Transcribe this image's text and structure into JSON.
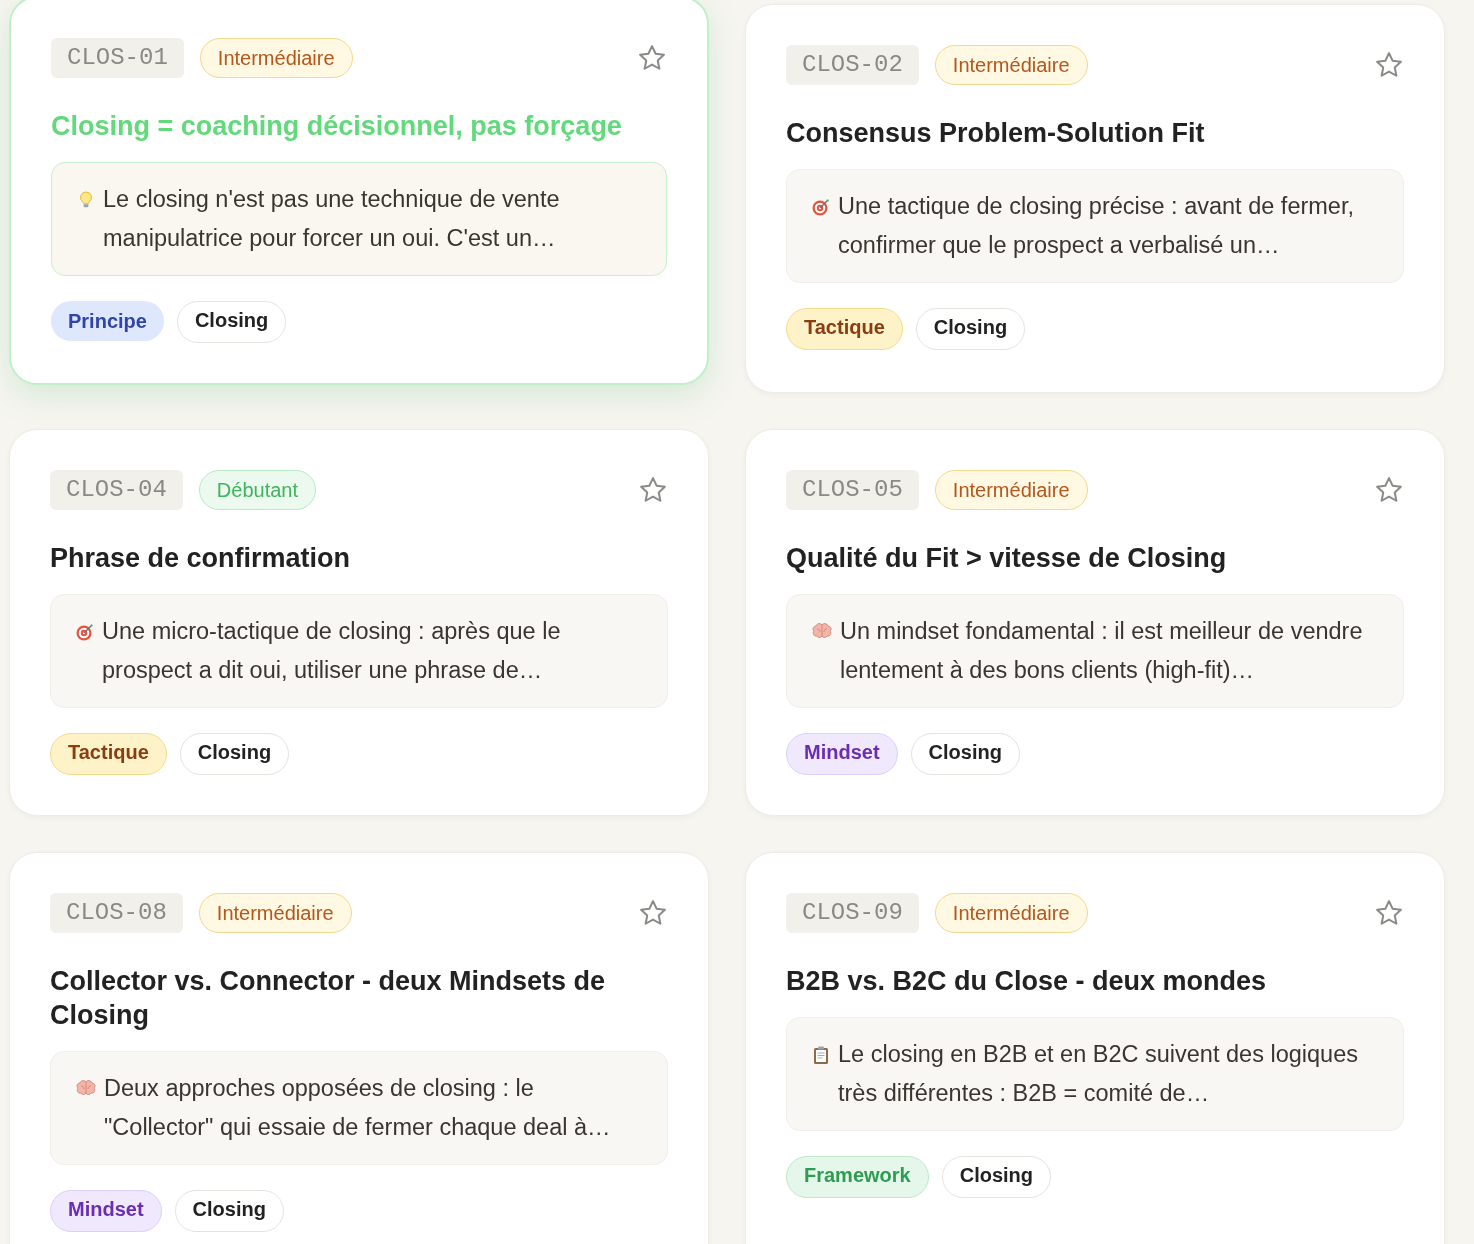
{
  "cards": [
    {
      "id": "CLOS-01",
      "selected": true,
      "starred": false,
      "difficulty": {
        "label": "Intermédiaire",
        "kind": "intermediate"
      },
      "title": "Closing = coaching décisionnel, pas forçage",
      "summary": {
        "kind": "idea",
        "text": "Le closing n'est pas une technique de vente manipulatrice pour forcer un oui. C'est un…"
      },
      "tags": [
        {
          "label": "Principe",
          "kind": "principle"
        },
        {
          "label": "Closing",
          "kind": "topic"
        }
      ]
    },
    {
      "id": "CLOS-02",
      "selected": false,
      "starred": false,
      "difficulty": {
        "label": "Intermédiaire",
        "kind": "intermediate"
      },
      "title": "Consensus Problem-Solution Fit",
      "summary": {
        "kind": "tactic",
        "text": "Une tactique de closing précise : avant de fermer, confirmer que le prospect a verbalisé un…"
      },
      "tags": [
        {
          "label": "Tactique",
          "kind": "tactic"
        },
        {
          "label": "Closing",
          "kind": "topic"
        }
      ]
    },
    {
      "id": "CLOS-04",
      "selected": false,
      "starred": false,
      "difficulty": {
        "label": "Débutant",
        "kind": "beginner"
      },
      "title": "Phrase de confirmation",
      "summary": {
        "kind": "tactic",
        "text": "Une micro-tactique de closing : après que le prospect a dit oui, utiliser une phrase de…"
      },
      "tags": [
        {
          "label": "Tactique",
          "kind": "tactic"
        },
        {
          "label": "Closing",
          "kind": "topic"
        }
      ]
    },
    {
      "id": "CLOS-05",
      "selected": false,
      "starred": false,
      "difficulty": {
        "label": "Intermédiaire",
        "kind": "intermediate"
      },
      "title": "Qualité du Fit > vitesse de Closing",
      "summary": {
        "kind": "mindset",
        "text": "Un mindset fondamental : il est meilleur de vendre lentement à des bons clients (high-fit)…"
      },
      "tags": [
        {
          "label": "Mindset",
          "kind": "mindset"
        },
        {
          "label": "Closing",
          "kind": "topic"
        }
      ]
    },
    {
      "id": "CLOS-08",
      "selected": false,
      "starred": false,
      "difficulty": {
        "label": "Intermédiaire",
        "kind": "intermediate"
      },
      "title": "Collector vs. Connector - deux Mindsets de Closing",
      "summary": {
        "kind": "mindset",
        "text": "Deux approches opposées de closing : le \"Collector\" qui essaie de fermer chaque deal à…"
      },
      "tags": [
        {
          "label": "Mindset",
          "kind": "mindset"
        },
        {
          "label": "Closing",
          "kind": "topic"
        }
      ]
    },
    {
      "id": "CLOS-09",
      "selected": false,
      "starred": false,
      "difficulty": {
        "label": "Intermédiaire",
        "kind": "intermediate"
      },
      "title": "B2B vs. B2C du Close - deux mondes",
      "summary": {
        "kind": "document",
        "text": "Le closing en B2B et en B2C suivent des logiques très différentes : B2B = comité de…"
      },
      "tags": [
        {
          "label": "Framework",
          "kind": "framework"
        },
        {
          "label": "Closing",
          "kind": "topic"
        }
      ]
    }
  ]
}
